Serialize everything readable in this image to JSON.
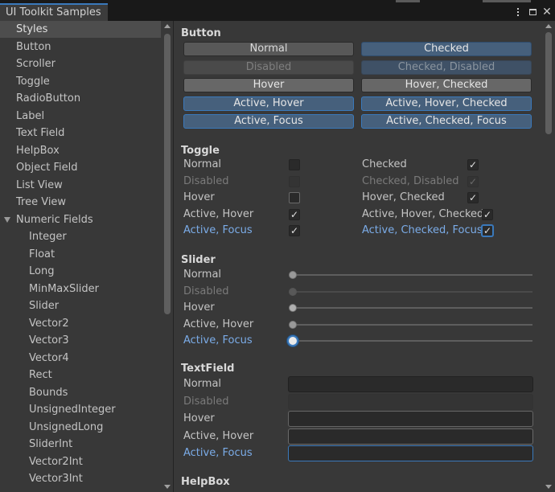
{
  "window": {
    "tab_title": "UI Toolkit Samples"
  },
  "sidebar": {
    "items": [
      {
        "label": "Styles"
      },
      {
        "label": "Button"
      },
      {
        "label": "Scroller"
      },
      {
        "label": "Toggle"
      },
      {
        "label": "RadioButton"
      },
      {
        "label": "Label"
      },
      {
        "label": "Text Field"
      },
      {
        "label": "HelpBox"
      },
      {
        "label": "Object Field"
      },
      {
        "label": "List View"
      },
      {
        "label": "Tree View"
      },
      {
        "label": "Numeric Fields"
      },
      {
        "label": "Integer"
      },
      {
        "label": "Float"
      },
      {
        "label": "Long"
      },
      {
        "label": "MinMaxSlider"
      },
      {
        "label": "Slider"
      },
      {
        "label": "Vector2"
      },
      {
        "label": "Vector3"
      },
      {
        "label": "Vector4"
      },
      {
        "label": "Rect"
      },
      {
        "label": "Bounds"
      },
      {
        "label": "UnsignedInteger"
      },
      {
        "label": "UnsignedLong"
      },
      {
        "label": "SliderInt"
      },
      {
        "label": "Vector2Int"
      },
      {
        "label": "Vector3Int"
      }
    ]
  },
  "content": {
    "button_section": {
      "title": "Button",
      "left": [
        "Normal",
        "Disabled",
        "Hover",
        "Active, Hover",
        "Active, Focus"
      ],
      "right": [
        "Checked",
        "Checked, Disabled",
        "Hover, Checked",
        "Active, Hover, Checked",
        "Active, Checked, Focus"
      ]
    },
    "toggle_section": {
      "title": "Toggle",
      "left": [
        "Normal",
        "Disabled",
        "Hover",
        "Active, Hover",
        "Active, Focus"
      ],
      "right": [
        "Checked",
        "Checked, Disabled",
        "Hover, Checked",
        "Active, Hover, Checked",
        "Active, Checked, Focus"
      ],
      "checkmark": "✓"
    },
    "slider_section": {
      "title": "Slider",
      "rows": [
        "Normal",
        "Disabled",
        "Hover",
        "Active, Hover",
        "Active, Focus"
      ]
    },
    "textfield_section": {
      "title": "TextField",
      "rows": [
        "Normal",
        "Disabled",
        "Hover",
        "Active, Hover",
        "Active, Focus"
      ]
    },
    "helpbox_section": {
      "title": "HelpBox"
    }
  },
  "colors": {
    "accent": "#3a79bb",
    "checked_button": "#46607c",
    "focus_text": "#7bace8",
    "panel_bg": "#383838"
  }
}
